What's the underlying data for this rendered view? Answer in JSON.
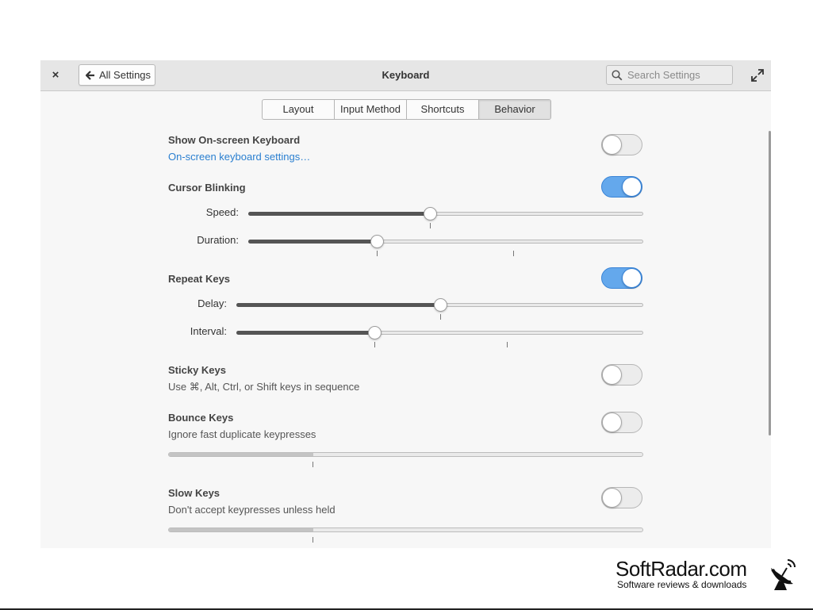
{
  "window": {
    "title": "Keyboard",
    "back_label": "All Settings",
    "close_glyph": "×",
    "search_placeholder": "Search Settings"
  },
  "tabs": [
    {
      "label": "Layout",
      "active": false
    },
    {
      "label": "Input Method",
      "active": false
    },
    {
      "label": "Shortcuts",
      "active": false
    },
    {
      "label": "Behavior",
      "active": true
    }
  ],
  "sections": {
    "onscreen": {
      "title": "Show On-screen Keyboard",
      "link": "On-screen keyboard settings…",
      "enabled": false
    },
    "cursor": {
      "title": "Cursor Blinking",
      "enabled": true,
      "speed_label": "Speed:",
      "speed_value": 0.46,
      "duration_label": "Duration:",
      "duration_value": 0.325
    },
    "repeat": {
      "title": "Repeat Keys",
      "enabled": true,
      "delay_label": "Delay:",
      "delay_value": 0.5,
      "interval_label": "Interval:",
      "interval_value": 0.34
    },
    "sticky": {
      "title": "Sticky Keys",
      "desc": "Use ⌘, Alt, Ctrl, or Shift keys in sequence",
      "enabled": false
    },
    "bounce": {
      "title": "Bounce Keys",
      "desc": "Ignore fast duplicate keypresses",
      "enabled": false,
      "level": 0.305
    },
    "slow": {
      "title": "Slow Keys",
      "desc": "Don't accept keypresses unless held",
      "enabled": false,
      "level": 0.305
    }
  },
  "watermark": {
    "title": "SoftRadar.com",
    "subtitle": "Software reviews & downloads"
  },
  "colors": {
    "accent": "#64a8ec",
    "link": "#2a7fd0",
    "titlebar": "#e6e6e6",
    "window_bg": "#f7f7f7"
  },
  "icons": {
    "back": "arrow-left-icon",
    "search": "search-icon",
    "expand": "expand-icon",
    "close": "close-icon",
    "watermark": "satellite-dish-icon"
  }
}
